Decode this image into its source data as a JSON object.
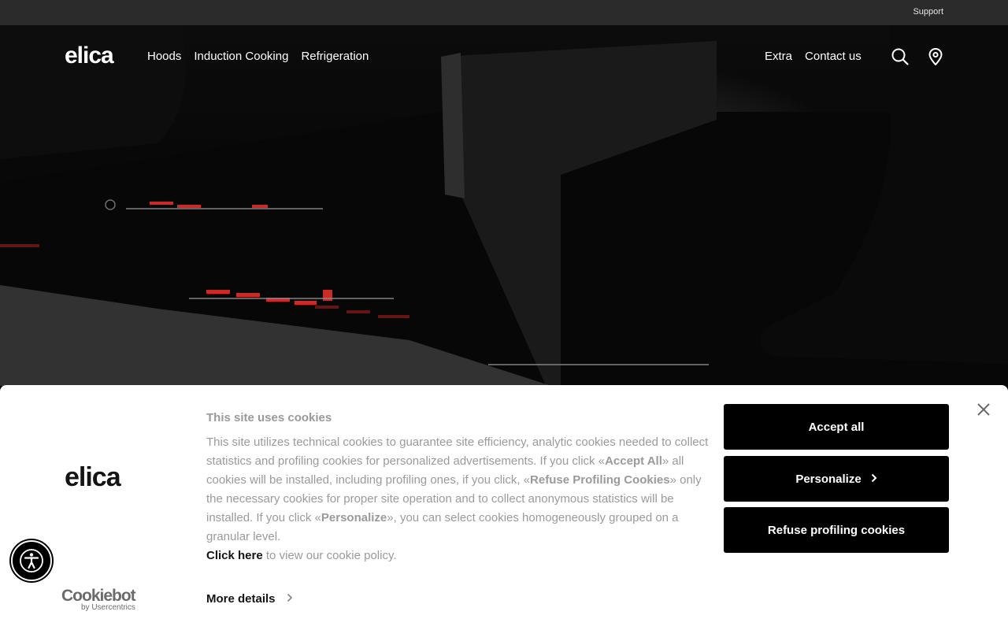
{
  "topbar": {
    "support": "Support"
  },
  "header": {
    "logo": "elica",
    "nav_left": [
      "Hoods",
      "Induction Cooking",
      "Refrigeration"
    ],
    "nav_right": [
      "Extra",
      "Contact us"
    ],
    "icons": [
      "search-icon",
      "location-pin-icon"
    ]
  },
  "cookie_banner": {
    "logo": "elica",
    "title": "This site uses cookies",
    "text_part1": "This site utilizes technical cookies to guarantee site efficiency, analytic cookies needed to collect statistics and profiling cookies for personalized advertisements. If you click «",
    "accept_all_em": "Accept All",
    "text_part2": "» all cookies will be installed, including profiling ones, if you click, «",
    "refuse_em": "Refuse Profiling Cookies",
    "text_part3": "» only the necessary cookies for proper site operation and to collect anonymous statistics will be installed. If you click «",
    "personalize_em": "Personalize",
    "text_part4": "», you can select cookies homogeneously grouped on a granular level.",
    "click_here": "Click here",
    "policy_text": " to view our cookie policy.",
    "more_details": "More details",
    "buttons": {
      "accept_all": "Accept all",
      "personalize": "Personalize",
      "refuse": "Refuse profiling cookies"
    },
    "cookiebot": "Cookiebot",
    "cookiebot_sub": "by Usercentrics"
  },
  "colors": {
    "topbar": "#2b2b2b",
    "button": "#000000",
    "muted_text": "#9a9a9a",
    "induction_red": "#e0302a"
  }
}
